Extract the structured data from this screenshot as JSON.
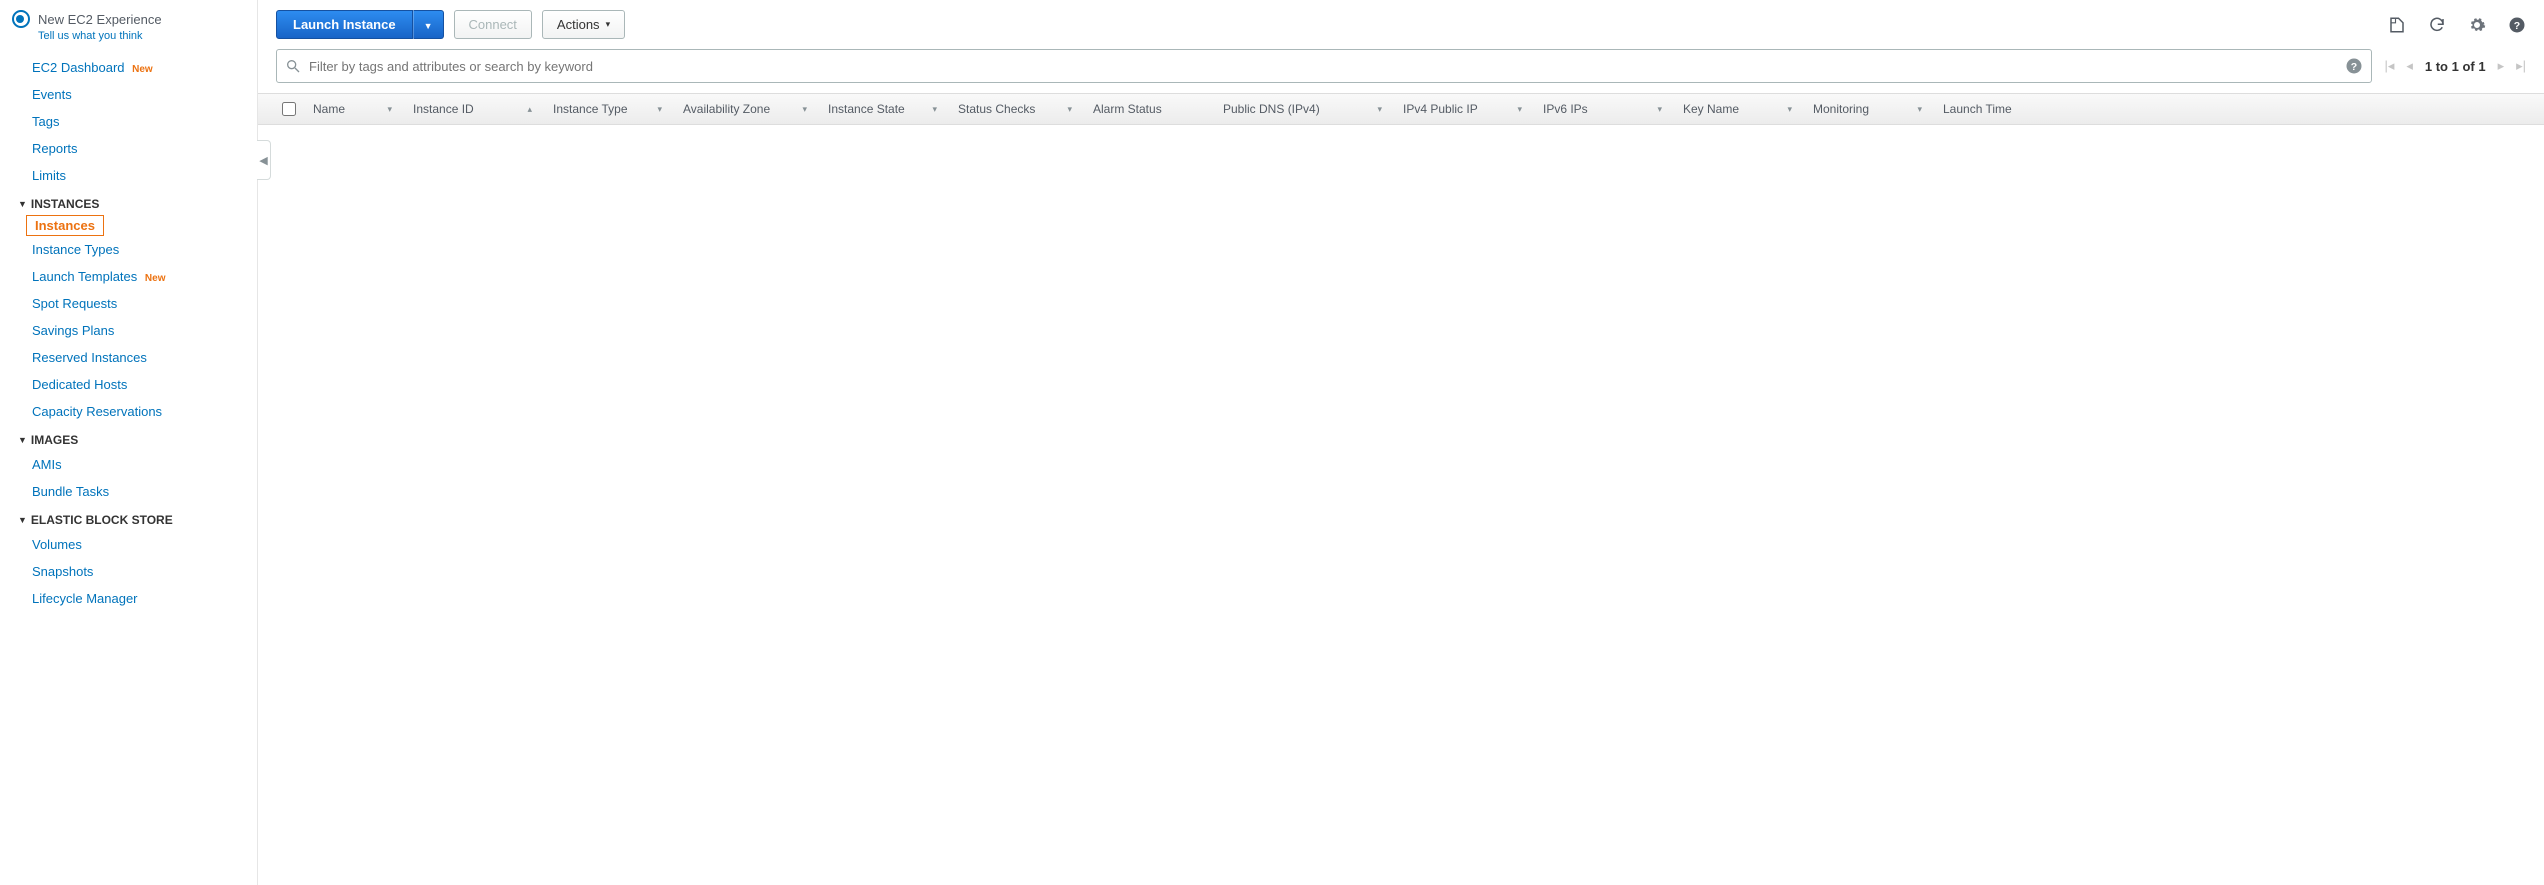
{
  "experience": {
    "title": "New EC2 Experience",
    "sub": "Tell us what you think"
  },
  "sidebar": {
    "top": [
      {
        "label": "EC2 Dashboard",
        "new": "New"
      },
      {
        "label": "Events"
      },
      {
        "label": "Tags"
      },
      {
        "label": "Reports"
      },
      {
        "label": "Limits"
      }
    ],
    "sections": [
      {
        "title": "INSTANCES",
        "items": [
          {
            "label": "Instances",
            "selected": true
          },
          {
            "label": "Instance Types"
          },
          {
            "label": "Launch Templates",
            "new": "New"
          },
          {
            "label": "Spot Requests"
          },
          {
            "label": "Savings Plans"
          },
          {
            "label": "Reserved Instances"
          },
          {
            "label": "Dedicated Hosts"
          },
          {
            "label": "Capacity Reservations"
          }
        ]
      },
      {
        "title": "IMAGES",
        "items": [
          {
            "label": "AMIs"
          },
          {
            "label": "Bundle Tasks"
          }
        ]
      },
      {
        "title": "ELASTIC BLOCK STORE",
        "items": [
          {
            "label": "Volumes"
          },
          {
            "label": "Snapshots"
          },
          {
            "label": "Lifecycle Manager"
          }
        ]
      }
    ]
  },
  "toolbar": {
    "launch": "Launch Instance",
    "connect": "Connect",
    "actions": "Actions"
  },
  "filter": {
    "placeholder": "Filter by tags and attributes or search by keyword"
  },
  "pager": {
    "text": "1 to 1 of 1"
  },
  "table": {
    "columns": [
      {
        "key": "name",
        "label": "Name",
        "sort": "neutral"
      },
      {
        "key": "iid",
        "label": "Instance ID",
        "sort": "asc"
      },
      {
        "key": "itype",
        "label": "Instance Type",
        "sort": "neutral"
      },
      {
        "key": "az",
        "label": "Availability Zone",
        "sort": "neutral"
      },
      {
        "key": "state",
        "label": "Instance State",
        "sort": "neutral"
      },
      {
        "key": "status",
        "label": "Status Checks",
        "sort": "neutral"
      },
      {
        "key": "alarm",
        "label": "Alarm Status"
      },
      {
        "key": "dns",
        "label": "Public DNS (IPv4)",
        "sort": "neutral"
      },
      {
        "key": "ip",
        "label": "IPv4 Public IP",
        "sort": "neutral"
      },
      {
        "key": "ipv6",
        "label": "IPv6 IPs",
        "sort": "neutral"
      },
      {
        "key": "key",
        "label": "Key Name",
        "sort": "neutral"
      },
      {
        "key": "mon",
        "label": "Monitoring",
        "sort": "neutral"
      },
      {
        "key": "launch",
        "label": "Launch Time"
      }
    ],
    "rows": []
  }
}
